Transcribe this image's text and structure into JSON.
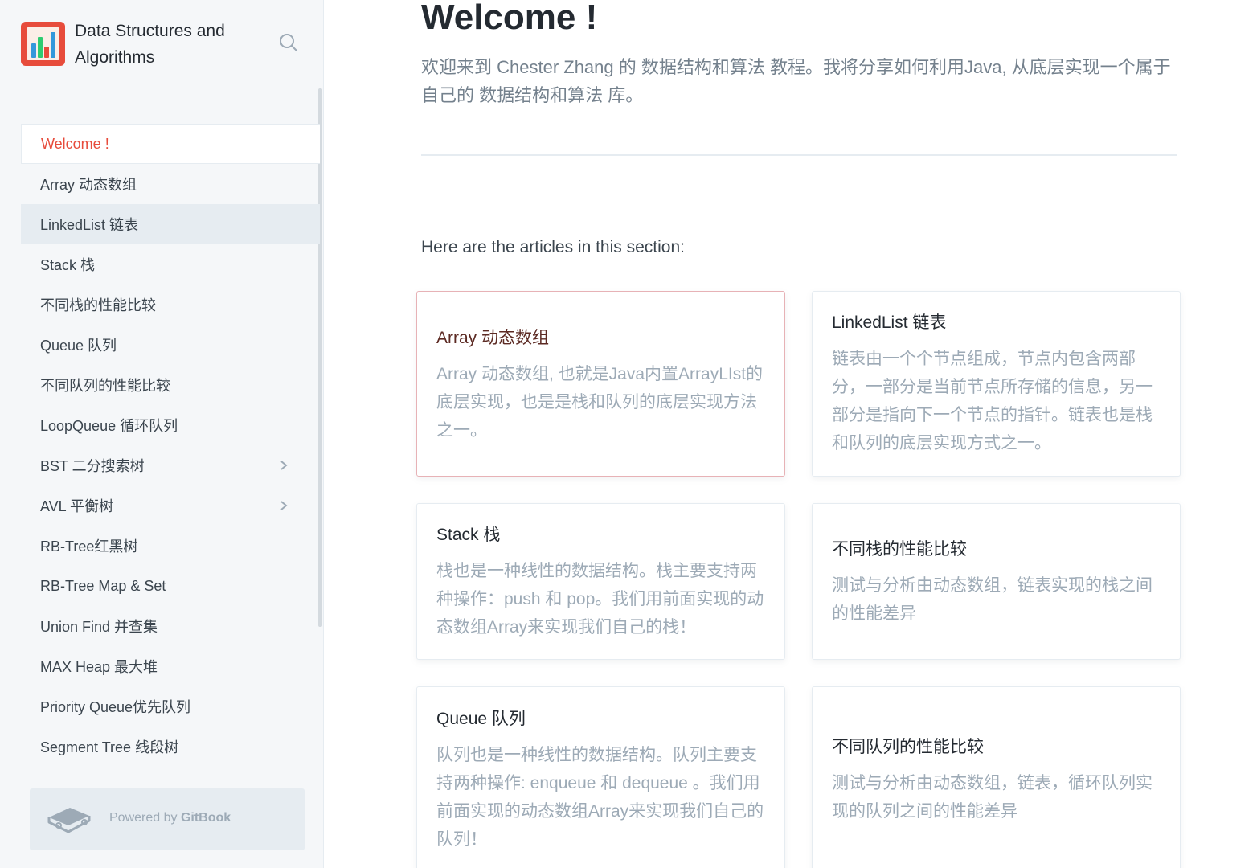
{
  "sidebar": {
    "brand_title": "Data Structures and Algorithms",
    "logo_icon": "bar-chart-logo",
    "search_icon": "search-icon",
    "items": [
      {
        "label": "Welcome !",
        "active": true
      },
      {
        "label": "Array 动态数组"
      },
      {
        "label": "LinkedList 链表",
        "hover": true
      },
      {
        "label": "Stack 栈"
      },
      {
        "label": "不同栈的性能比较"
      },
      {
        "label": "Queue 队列"
      },
      {
        "label": "不同队列的性能比较"
      },
      {
        "label": "LoopQueue 循环队列"
      },
      {
        "label": "BST 二分搜索树",
        "expandable": true
      },
      {
        "label": "AVL 平衡树",
        "expandable": true
      },
      {
        "label": "RB-Tree红黑树"
      },
      {
        "label": "RB-Tree Map & Set"
      },
      {
        "label": "Union Find 并查集"
      },
      {
        "label": "MAX Heap 最大堆"
      },
      {
        "label": "Priority Queue优先队列"
      },
      {
        "label": "Segment Tree 线段树"
      }
    ],
    "footer": {
      "prefix": "Powered by ",
      "brand": "GitBook"
    }
  },
  "main": {
    "title": "Welcome !",
    "intro": "欢迎来到 Chester Zhang 的 数据结构和算法 教程。我将分享如何利用Java, 从底层实现一个属于自己的 数据结构和算法 库。",
    "section_label": "Here are the articles in this section:",
    "cards": [
      {
        "title": "Array 动态数组",
        "desc": "Array 动态数组, 也就是Java内置ArrayLIst的底层实现，也是是栈和队列的底层实现方法之一。"
      },
      {
        "title": "LinkedList 链表",
        "desc": "链表由一个个节点组成，节点内包含两部分，一部分是当前节点所存储的信息，另一部分是指向下一个节点的指针。链表也是栈和队列的底层实现方式之一。"
      },
      {
        "title": "Stack 栈",
        "desc": "栈也是一种线性的数据结构。栈主要支持两种操作：push 和 pop。我们用前面实现的动态数组Array来实现我们自己的栈！"
      },
      {
        "title": "不同栈的性能比较",
        "desc": "测试与分析由动态数组，链表实现的栈之间的性能差异"
      },
      {
        "title": "Queue 队列",
        "desc": "队列也是一种线性的数据结构。队列主要支持两种操作: enqueue 和 dequeue 。我们用前面实现的动态数组Array来实现我们自己的队列！"
      },
      {
        "title": "不同队列的性能比较",
        "desc": "测试与分析由动态数组，链表，循环队列实现的队列之间的性能差异"
      }
    ]
  },
  "colors": {
    "accent": "#e74c3c",
    "muted": "#9daab6",
    "border": "#e6ecf1"
  }
}
